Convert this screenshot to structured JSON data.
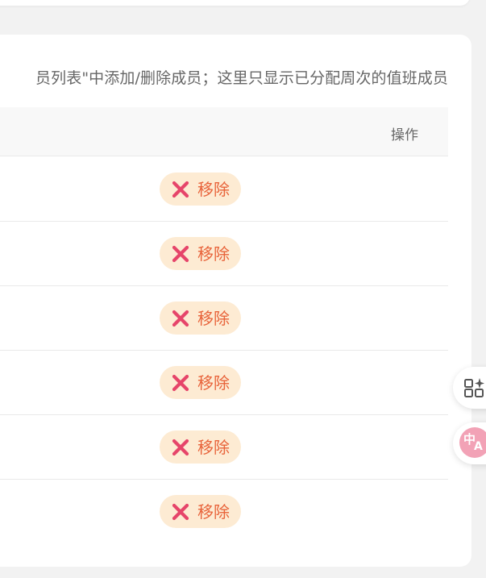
{
  "hint_text": "员列表\"中添加/删除成员；这里只显示已分配周次的值班成员",
  "table": {
    "header_action": "操作",
    "rows": [
      {
        "action_label": "移除"
      },
      {
        "action_label": "移除"
      },
      {
        "action_label": "移除"
      },
      {
        "action_label": "移除"
      },
      {
        "action_label": "移除"
      },
      {
        "action_label": "移除"
      }
    ]
  },
  "floating": {
    "apps_icon": "grid-sparkle-icon",
    "translate_icon": "translate-icon",
    "translate_glyphs": [
      "中",
      "A"
    ]
  },
  "colors": {
    "remove_bg": "#fdebd3",
    "remove_text": "#e8633a",
    "remove_x": "#e6456a"
  }
}
